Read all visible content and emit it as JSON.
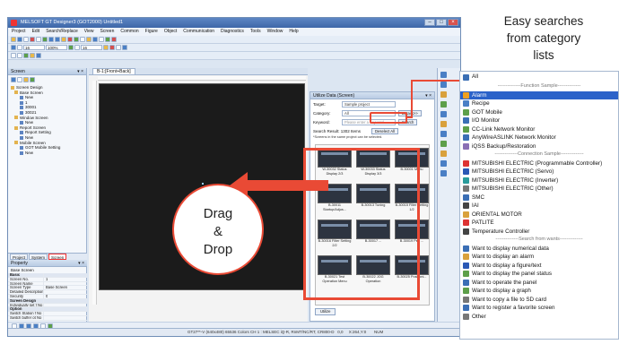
{
  "callout": {
    "lines": [
      "Easy searches",
      "from category",
      "lists"
    ]
  },
  "drag_label": {
    "lines": [
      "Drag",
      "&",
      "Drop"
    ]
  },
  "app": {
    "title": "MELSOFT GT Designer3 (GOT2000) Untitled1",
    "menu": [
      "Project",
      "Edit",
      "Search/Replace",
      "View",
      "Screen",
      "Common",
      "Figure",
      "Object",
      "Communication",
      "Diagnostics",
      "Tools",
      "Window",
      "Help"
    ],
    "zoom": "100%",
    "screen_pane": {
      "title": "Screen",
      "tree": [
        {
          "label": "Screen Design",
          "level": 0
        },
        {
          "label": "Base Screen",
          "level": 1
        },
        {
          "label": "New",
          "level": 2
        },
        {
          "label": "1",
          "level": 2
        },
        {
          "label": "30001",
          "level": 2
        },
        {
          "label": "30021",
          "level": 2
        },
        {
          "label": "Window Screen",
          "level": 1
        },
        {
          "label": "New",
          "level": 2
        },
        {
          "label": "Report Screen",
          "level": 1
        },
        {
          "label": "Report Setting",
          "level": 2
        },
        {
          "label": "New",
          "level": 2
        },
        {
          "label": "Mobile Screen",
          "level": 1
        },
        {
          "label": "GOT Mobile Setting",
          "level": 2
        },
        {
          "label": "New",
          "level": 2
        }
      ],
      "tabs": [
        "Project",
        "System",
        "Screen"
      ]
    },
    "property_pane": {
      "title": "Property",
      "subtitle": "Base Screen",
      "rows": [
        {
          "key": "Basic",
          "value": "",
          "section": true
        },
        {
          "key": "Screen No.",
          "value": "1"
        },
        {
          "key": "Screen Name",
          "value": ""
        },
        {
          "key": "Screen Type",
          "value": "Base Screen"
        },
        {
          "key": "Detailed Description",
          "value": ""
        },
        {
          "key": "Security",
          "value": "0"
        },
        {
          "key": "Screen Design",
          "value": "",
          "section": true
        },
        {
          "key": "Individually set f No",
          "value": ""
        },
        {
          "key": "Option",
          "value": "",
          "section": true
        },
        {
          "key": "Switch Station f No",
          "value": ""
        },
        {
          "key": "Switch buffer ot No",
          "value": ""
        }
      ]
    },
    "editor": {
      "tab": "B-1:[Front+Back]"
    },
    "utility": {
      "title": "Utilize Data (Screen)",
      "target_label": "Target:",
      "target_value": "Sample project",
      "category_label": "Category:",
      "category_value": "All",
      "details_button": "Details>>",
      "keyword_label": "Keyword:",
      "keyword_placeholder": "Please enter a keyword",
      "search_button": "Search",
      "result_label": "Search Result: 1302 Items",
      "deselect_button": "Deselect All",
      "note": "*Screens in the same project can be selected.",
      "thumbnails": [
        "",
        "",
        "",
        "W-30032 Status Display 2/3",
        "W-30033 Status Display 3/3",
        "B-30001 Menu",
        "",
        "",
        "",
        "B-30011 Startup/Adjus...",
        "B-30013 Tuning",
        "B-30015 Filter Setting 1/2",
        "",
        "",
        "",
        "B-30016 Filter Setting 2/2",
        "B-30017 ...",
        "B-30019 Peo ...",
        "",
        "",
        "",
        "B-30021 Test Operation Menu",
        "B-30022 JOG Operation",
        "B-30025 Positioni..."
      ],
      "utilize_button": "Utilize"
    },
    "status": "GT27**-V (640x480)  65536 Colors  CH 1 : MELSEC iQ-R, RnMT/NC/RT, CR800-D    0,0     X:264,Y:0       NUM"
  },
  "category_list": {
    "header": "All",
    "items": [
      {
        "label": "Function Sample",
        "type": "separator"
      },
      {
        "label": "Alarm",
        "type": "item",
        "selected": true,
        "icon_color": "#f0a020"
      },
      {
        "label": "Recipe",
        "type": "item",
        "icon_color": "#4a7fc5"
      },
      {
        "label": "GOT Mobile",
        "type": "item",
        "icon_color": "#5d9f4a"
      },
      {
        "label": "I/O Monitor",
        "type": "item",
        "icon_color": "#3b6fb5"
      },
      {
        "label": "CC-Link Network Monitor",
        "type": "item",
        "icon_color": "#5d9f4a"
      },
      {
        "label": "AnyWireASLINK Network Monitor",
        "type": "item",
        "icon_color": "#3b6fb5"
      },
      {
        "label": "iQSS Backup/Restoration",
        "type": "item",
        "icon_color": "#8a6fb5"
      },
      {
        "label": "Connection Sample",
        "type": "separator"
      },
      {
        "label": "MITSUBISHI ELECTRIC (Programmable Controller)",
        "type": "item",
        "icon_color": "#d33"
      },
      {
        "label": "MITSUBISHI ELECTRIC (Servo)",
        "type": "item",
        "icon_color": "#2a58b5"
      },
      {
        "label": "MITSUBISHI ELECTRIC (Inverter)",
        "type": "item",
        "icon_color": "#2a9c9c"
      },
      {
        "label": "MITSUBISHI ELECTRIC (Other)",
        "type": "item",
        "icon_color": "#777"
      },
      {
        "label": "SMC",
        "type": "item",
        "icon_color": "#3b6fb5"
      },
      {
        "label": "IAI",
        "type": "item",
        "icon_color": "#444"
      },
      {
        "label": "ORIENTAL MOTOR",
        "type": "item",
        "icon_color": "#d9a13c"
      },
      {
        "label": "PATLITE",
        "type": "item",
        "icon_color": "#d33"
      },
      {
        "label": "Temperature Controller",
        "type": "item",
        "icon_color": "#444"
      },
      {
        "label": "Search from wants",
        "type": "separator"
      },
      {
        "label": "Want to display numerical data",
        "type": "item",
        "icon_color": "#3b6fb5"
      },
      {
        "label": "Want to display an alarm",
        "type": "item",
        "icon_color": "#d9a13c"
      },
      {
        "label": "Want to display a figure/text",
        "type": "item",
        "icon_color": "#2a58b5"
      },
      {
        "label": "Want to display the panel status",
        "type": "item",
        "icon_color": "#5d9f4a"
      },
      {
        "label": "Want to operate the panel",
        "type": "item",
        "icon_color": "#3b6fb5"
      },
      {
        "label": "Want to display a graph",
        "type": "item",
        "icon_color": "#5d9f4a"
      },
      {
        "label": "Want to copy a file to SD card",
        "type": "item",
        "icon_color": "#777"
      },
      {
        "label": "Want to register a favorite screen",
        "type": "item",
        "icon_color": "#3b6fb5"
      },
      {
        "label": "Other",
        "type": "item",
        "icon_color": "#777"
      }
    ]
  },
  "colors": {
    "accent": "#e94a35",
    "selection": "#2b62c9",
    "frame": "#6f8db6"
  }
}
